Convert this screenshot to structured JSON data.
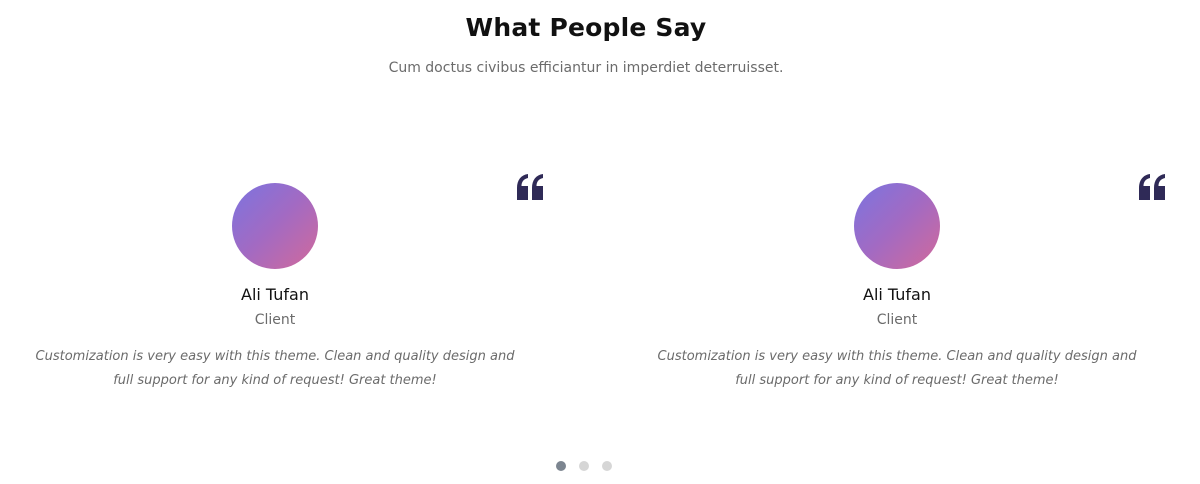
{
  "section": {
    "title": "What People Say",
    "subtitle": "Cum doctus civibus efficiantur in imperdiet deterruisset."
  },
  "testimonials": [
    {
      "name": "Ali Tufan",
      "role": "Client",
      "text": "Customization is very easy with this theme. Clean and quality design and full support for any kind of request! Great theme!",
      "icon": "quote-icon"
    },
    {
      "name": "Ali Tufan",
      "role": "Client",
      "text": "Customization is very easy with this theme. Clean and quality design and full support for any kind of request! Great theme!",
      "icon": "quote-icon"
    }
  ],
  "carousel": {
    "dot_count": 3,
    "active_index": 0
  },
  "colors": {
    "quote_icon": "#2f2a57",
    "avatar_gradient_start": "#7b74e0",
    "avatar_gradient_end": "#d2699a",
    "dot_active": "#7c8590",
    "dot_inactive": "#d6d6d6"
  }
}
